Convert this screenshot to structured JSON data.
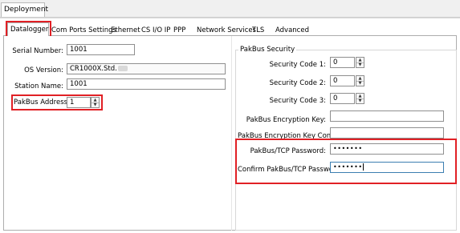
{
  "top_tab": {
    "label": "Deployment"
  },
  "tabs": [
    {
      "label": "Datalogger"
    },
    {
      "label": "Com Ports Settings"
    },
    {
      "label": "Ethernet"
    },
    {
      "label": "CS I/O IP"
    },
    {
      "label": "PPP"
    },
    {
      "label": "Network Services"
    },
    {
      "label": "TLS"
    },
    {
      "label": "Advanced"
    }
  ],
  "left": {
    "serial_number": {
      "label": "Serial Number:",
      "value": "1001"
    },
    "os_version": {
      "label": "OS Version:",
      "value": "CR1000X.Std."
    },
    "station_name": {
      "label": "Station Name:",
      "value": "1001"
    },
    "pakbus_address": {
      "label": "PakBus Address:",
      "value": "1"
    }
  },
  "security": {
    "group_title": "PakBus Security",
    "code1": {
      "label": "Security Code 1:",
      "value": "0"
    },
    "code2": {
      "label": "Security Code 2:",
      "value": "0"
    },
    "code3": {
      "label": "Security Code 3:",
      "value": "0"
    },
    "enc_key": {
      "label": "PakBus Encryption Key:",
      "value": ""
    },
    "enc_key_confirm": {
      "label": "PakBus Encryption Key Confirm:",
      "value": ""
    },
    "tcp_password": {
      "label": "PakBus/TCP Password:",
      "value": "•••••••"
    },
    "tcp_password_confirm": {
      "label": "Confirm PakBus/TCP Password:",
      "value": "•••••••"
    }
  },
  "colors": {
    "highlight": "#e12025",
    "focus_border": "#3c7fb1"
  }
}
